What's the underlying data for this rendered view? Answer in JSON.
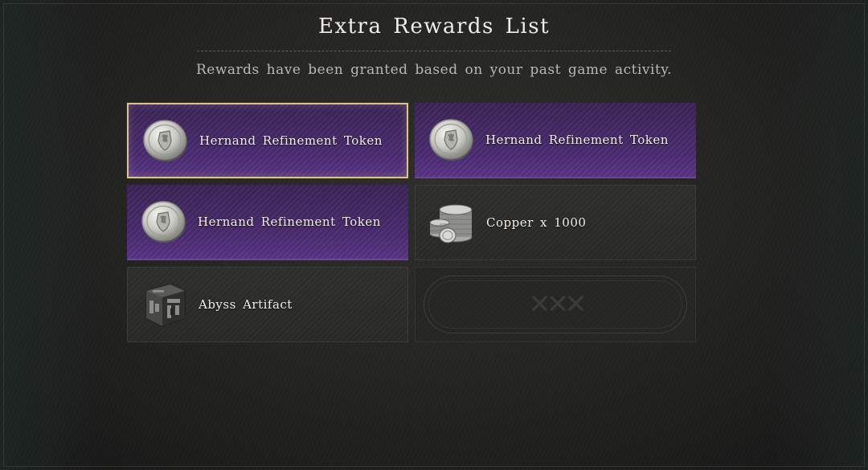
{
  "header": {
    "title": "Extra Rewards List",
    "subtitle": "Rewards have been granted based on your past game activity."
  },
  "rewards": [
    {
      "label": "Hernand Refinement Token",
      "icon": "hernand-token-coin-icon",
      "rarity": "purple",
      "selected": true
    },
    {
      "label": "Hernand Refinement Token",
      "icon": "hernand-token-coin-icon",
      "rarity": "purple",
      "selected": false
    },
    {
      "label": "Hernand Refinement Token",
      "icon": "hernand-token-coin-icon",
      "rarity": "purple",
      "selected": false
    },
    {
      "label": "Copper x 1000",
      "icon": "copper-coin-stack-icon",
      "rarity": "common",
      "selected": false
    },
    {
      "label": "Abyss Artifact",
      "icon": "abyss-artifact-cube-icon",
      "rarity": "common",
      "selected": false
    }
  ],
  "colors": {
    "purple_slot": "#4b2c72",
    "selected_border": "#d8c48e",
    "common_slot": "#2d2d2b"
  }
}
